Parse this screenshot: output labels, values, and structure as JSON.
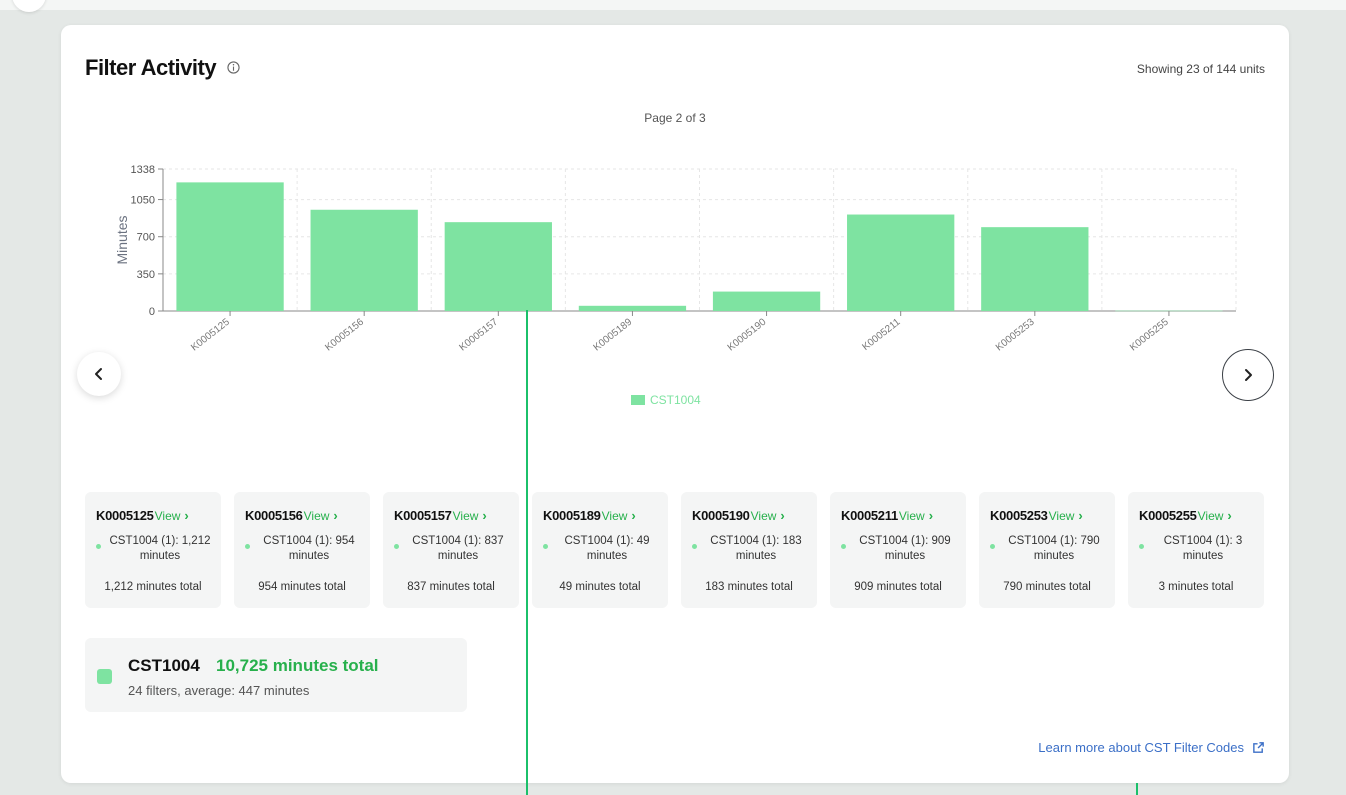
{
  "header": {
    "title": "Filter Activity",
    "showing": "Showing 23 of 144 units",
    "page_info": "Page 2 of 3"
  },
  "colors": {
    "bar": "#7ee3a1",
    "accent_green": "#27b04c",
    "link": "#3b6fc7"
  },
  "icons": {
    "info": "info-circle-icon",
    "prev": "chevron-left-icon",
    "next": "chevron-right-icon",
    "external": "external-link-icon"
  },
  "chart_data": {
    "type": "bar",
    "ylabel": "Minutes",
    "yticks": [
      0,
      350,
      700,
      1050,
      1338
    ],
    "ylim": [
      0,
      1338
    ],
    "categories": [
      "K0005125",
      "K0005156",
      "K0005157",
      "K0005189",
      "K0005190",
      "K0005211",
      "K0005253",
      "K0005255"
    ],
    "series": [
      {
        "name": "CST1004",
        "values": [
          1212,
          954,
          837,
          49,
          183,
          909,
          790,
          3
        ]
      }
    ],
    "grid": true,
    "legend": "bottom-center"
  },
  "legend_label": "CST1004",
  "units": [
    {
      "id": "K0005125",
      "view": "View",
      "detail": "CST1004 (1): 1,212 minutes",
      "total": "1,212 minutes total"
    },
    {
      "id": "K0005156",
      "view": "View",
      "detail": "CST1004 (1): 954 minutes",
      "total": "954 minutes total"
    },
    {
      "id": "K0005157",
      "view": "View",
      "detail": "CST1004 (1): 837 minutes",
      "total": "837 minutes total"
    },
    {
      "id": "K0005189",
      "view": "View",
      "detail": "CST1004 (1): 49 minutes",
      "total": "49 minutes total"
    },
    {
      "id": "K0005190",
      "view": "View",
      "detail": "CST1004 (1): 183 minutes",
      "total": "183 minutes total"
    },
    {
      "id": "K0005211",
      "view": "View",
      "detail": "CST1004 (1): 909 minutes",
      "total": "909 minutes total"
    },
    {
      "id": "K0005253",
      "view": "View",
      "detail": "CST1004 (1): 790 minutes",
      "total": "790 minutes total"
    },
    {
      "id": "K0005255",
      "view": "View",
      "detail": "CST1004 (1): 3 minutes",
      "total": "3 minutes total"
    }
  ],
  "summary": {
    "code": "CST1004",
    "total": "10,725 minutes total",
    "sub": "24 filters, average: 447 minutes"
  },
  "footer": {
    "learn_more": "Learn more about CST Filter Codes"
  }
}
